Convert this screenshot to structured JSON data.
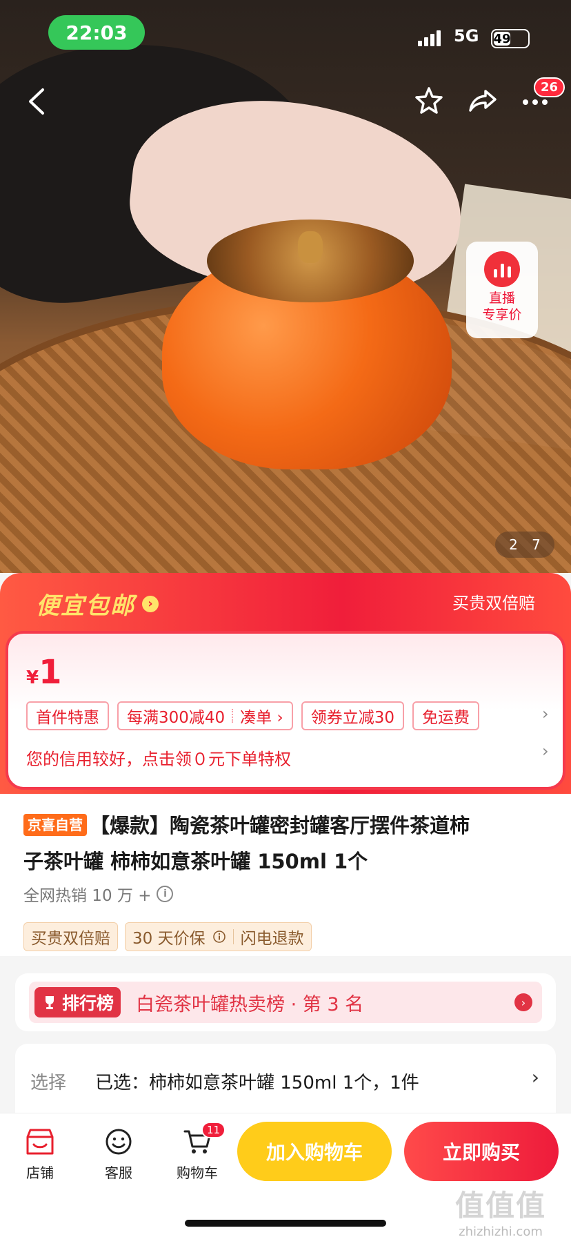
{
  "status_bar": {
    "time": "22:03",
    "network": "5G",
    "battery": "49"
  },
  "nav": {
    "more_badge": "26"
  },
  "hero": {
    "live": {
      "line1": "直播",
      "line2": "专享价"
    },
    "pager": {
      "current": "2",
      "total": "7"
    }
  },
  "promo": {
    "title": "便宜包邮",
    "arrow": "›",
    "right_text": "买贵双倍赔",
    "currency": "¥",
    "price": "1",
    "tags": [
      {
        "label": "首件特惠"
      },
      {
        "label": "每满300减40",
        "action": "凑单 ›"
      },
      {
        "label": "领券立减30"
      },
      {
        "label": "免运费"
      }
    ],
    "tags_more": "›",
    "credit_text": "您的信用较好，点击领０元下单特权",
    "credit_more": "›"
  },
  "product": {
    "self_operated": "京喜自营",
    "title_line1": "【爆款】陶瓷茶叶罐密封罐客厅摆件茶道柿",
    "title_line2": "子茶叶罐 柿柿如意茶叶罐 150ml 1个",
    "sales": "全网热销 10 万 +",
    "info_icon": "i",
    "badges": {
      "double_refund": "买贵双倍赔",
      "price_protect": "30 天价保",
      "flash_refund": "闪电退款"
    }
  },
  "ranking": {
    "tag": "排行榜",
    "text": "白瓷茶叶罐热卖榜 · 第 3 名",
    "go": "›"
  },
  "selection": {
    "label": "选择",
    "value": "已选：柿柿如意茶叶罐 150ml 1个，1件",
    "arrow": "›"
  },
  "bottom_bar": {
    "store": "店铺",
    "service": "客服",
    "cart": "购物车",
    "cart_count": "11",
    "add_to_cart": "加入购物车",
    "buy_now": "立即购买"
  },
  "watermark": {
    "logo": "值值值",
    "url": "zhizhizhi.com"
  },
  "colors": {
    "accent_red": "#f01e3a",
    "promo_yellow": "#ffe36a",
    "add_cart_yellow": "#ffcc1a",
    "status_green": "#35c759"
  }
}
